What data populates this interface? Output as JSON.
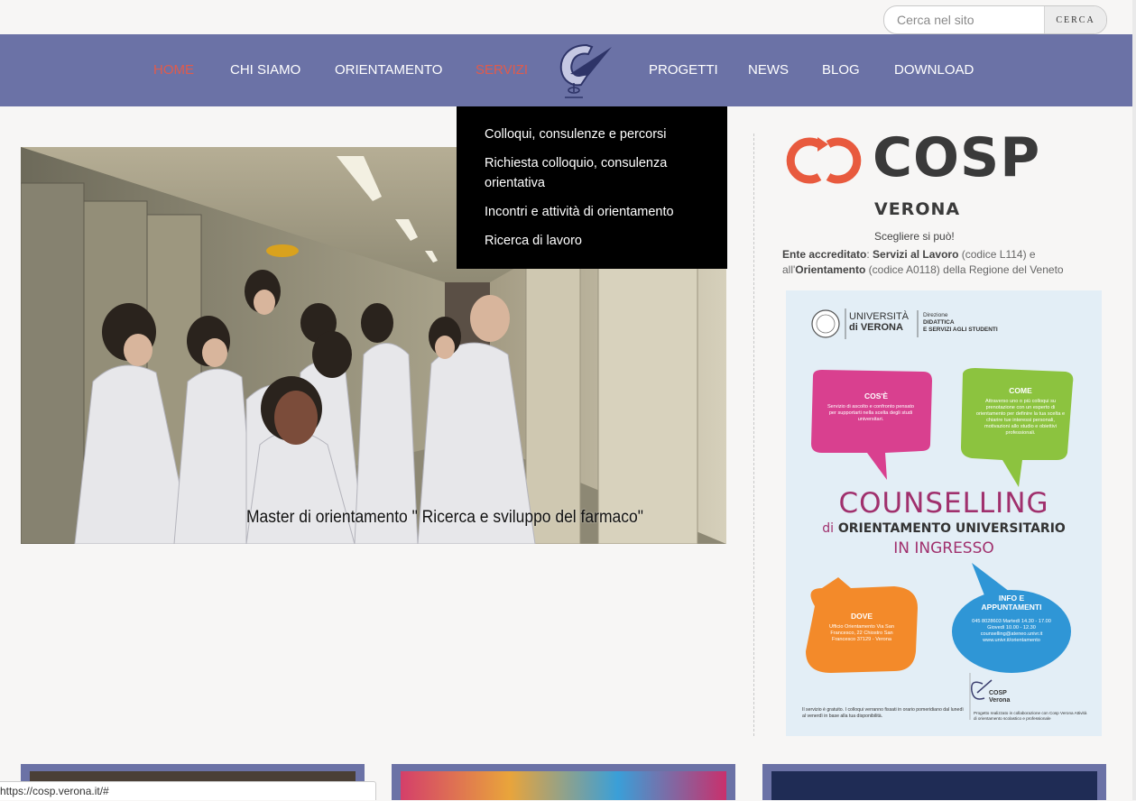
{
  "search": {
    "placeholder": "Cerca nel sito",
    "button_label": "CERCA"
  },
  "nav": {
    "items": [
      {
        "label": "HOME",
        "active": true
      },
      {
        "label": "CHI SIAMO"
      },
      {
        "label": "ORIENTAMENTO"
      },
      {
        "label": "SERVIZI",
        "active": true
      },
      {
        "label": "PROGETTI"
      },
      {
        "label": "NEWS"
      },
      {
        "label": "BLOG"
      },
      {
        "label": "DOWNLOAD"
      }
    ]
  },
  "dropdown": {
    "items": [
      "Colloqui, consulenze e percorsi",
      "Richiesta colloquio, consulenza orientativa",
      "Incontri e attività di orientamento",
      "Ricerca di lavoro"
    ]
  },
  "slider": {
    "caption": "Master di orientamento \" Ricerca e sviluppo del farmaco\""
  },
  "sidebar": {
    "brand": "COSP",
    "city": "VERONA",
    "tagline": "Scegliere si può!",
    "accred": {
      "p1": "Ente accreditato",
      "p2": ": ",
      "p3": "Servizi al Lavoro",
      "p4": " (codice L114) e all'",
      "p5": "Orientamento",
      "p6": " (codice A0118) della Regione del Veneto"
    }
  },
  "poster": {
    "uni_line1": "UNIVERSITÀ",
    "uni_line2": "di VERONA",
    "dir_line1": "Direzione",
    "dir_line2": "DIDATTICA",
    "dir_line3": "E SERVIZI AGLI STUDENTI",
    "cose_title": "COS'È",
    "cose_text": "Servizio di ascolto e confronto pensato per supportarti nella scelta degli studi universitari.",
    "come_title": "COME",
    "come_text": "Attraverso uno o più colloqui su prenotazione con un esperto di orientamento per definire la tua scelta e chiarire tue interessi personali, motivazioni allo studio e obiettivi professionali.",
    "title1": "COUNSELLING",
    "title2_di": "di",
    "title2": "ORIENTAMENTO UNIVERSITARIO",
    "title3": "IN INGRESSO",
    "dove_title": "DOVE",
    "dove_text": "Ufficio Orientamento Via San Francesco, 22 Chiostro San Francesco 37129 - Verona",
    "info_title": "INFO E APPUNTAMENTI",
    "info_text": "045 8028603 Martedì 14.30 - 17.00 Giovedì 10.00 - 12.30 counselling@ateneo.univr.it www.univr.it/orientamento",
    "logo_label1": "COSP",
    "logo_label2": "Verona",
    "foot_text": "Il servizio è gratuito. I colloqui verranno fissati in orario pomeridiano dal lunedì al venerdì in base alla tua disponibilità.",
    "foot_text2": "Progetto realizzato in collaborazione con Cosp Verona Attività di orientamento scolastico e professionale"
  },
  "status_url": "https://cosp.verona.it/#",
  "colors": {
    "nav": "#6b72a6",
    "active": "#e05b4c",
    "brand_orange": "#e85a3e"
  }
}
